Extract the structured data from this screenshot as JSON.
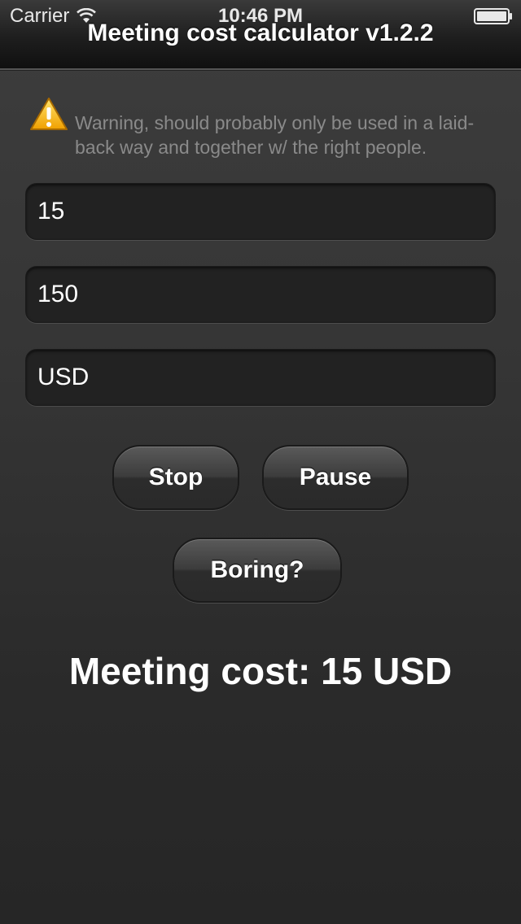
{
  "status_bar": {
    "carrier": "Carrier",
    "time": "10:46 PM",
    "wifi_icon": "wifi-icon",
    "battery_icon": "battery-icon"
  },
  "header": {
    "title": "Meeting cost calculator v1.2.2"
  },
  "warning": {
    "icon": "warning-icon",
    "text": "Warning, should probably only be used in a laid-back way and together w/ the right people."
  },
  "inputs": {
    "field1_value": "15",
    "field2_value": "150",
    "field3_value": "USD"
  },
  "buttons": {
    "stop_label": "Stop",
    "pause_label": "Pause",
    "boring_label": "Boring?"
  },
  "result": {
    "text": "Meeting cost: 15 USD"
  },
  "colors": {
    "background": "#353535",
    "field_background": "#222222",
    "warning_text": "#8a8a8a",
    "text": "#ffffff"
  }
}
